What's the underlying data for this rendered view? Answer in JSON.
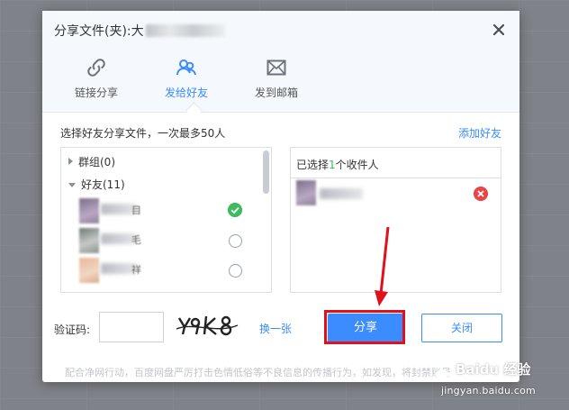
{
  "dialog": {
    "title": "分享文件(夹):大",
    "tabs": [
      {
        "label": "链接分享",
        "icon": "link-icon"
      },
      {
        "label": "发给好友",
        "icon": "friends-icon",
        "active": true
      },
      {
        "label": "发到邮箱",
        "icon": "mail-icon"
      }
    ],
    "hint": "选择好友分享文件，一次最多50人",
    "add_friend": "添加好友",
    "groups": [
      {
        "label": "群组(0)",
        "expanded": false
      },
      {
        "label": "好友(11)",
        "expanded": true
      }
    ],
    "friends": [
      {
        "name_end": "目",
        "checked": true,
        "avatar_colors": [
          "#7a6f86",
          "#b9a7c4"
        ]
      },
      {
        "name_end": "毛",
        "checked": false,
        "avatar_colors": [
          "#6f7a78",
          "#c6c8c5"
        ]
      },
      {
        "name_end": "祥",
        "checked": false,
        "avatar_colors": [
          "#e7b89a",
          "#f1d7c4"
        ]
      }
    ],
    "selected_prefix": "已选择",
    "selected_count": "1",
    "selected_suffix": "个收件人",
    "captcha_label": "验证码:",
    "captcha_text": "Y9K8",
    "refresh": "换一张",
    "share_button": "分享",
    "close_button": "关闭",
    "notice": "配合净网行动，百度网盘严厉打击色情低俗等不良信息的传播行为，如发现，将封禁账号"
  },
  "watermark": {
    "brand": "Baidu 经验",
    "url": "jingyan.baidu.com"
  },
  "colors": {
    "accent": "#3b8cff",
    "success": "#3dbb5e",
    "danger": "#e84545",
    "highlight": "#e0111a"
  }
}
